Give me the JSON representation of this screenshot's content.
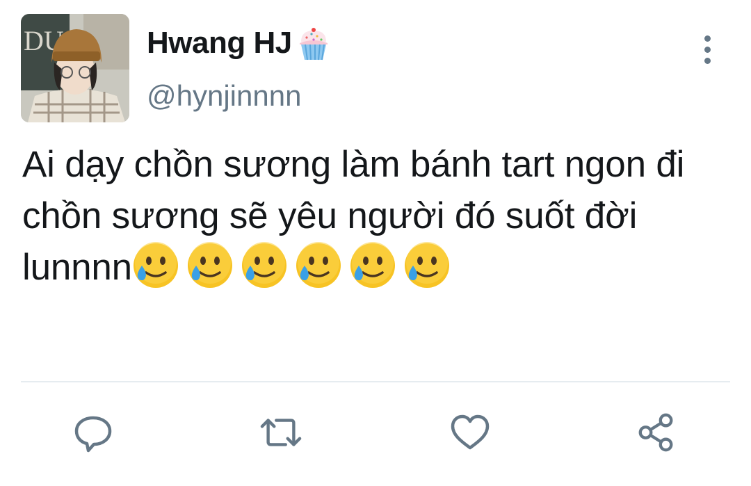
{
  "tweet": {
    "display_name": "Hwang HJ",
    "handle": "@hynjinnnn",
    "text": "Ai dạy chồn sương làm bánh tart ngon đi chồn sương sẽ yêu người đó suốt đời lunnnn",
    "emojis": [
      "smiling-face-with-tear",
      "smiling-face-with-tear",
      "smiling-face-with-tear",
      "smiling-face-with-tear",
      "smiling-face-with-tear",
      "smiling-face-with-tear"
    ],
    "name_badge_icon": "cupcake-icon"
  },
  "actions": [
    {
      "name": "reply",
      "icon": "comment-icon"
    },
    {
      "name": "retweet",
      "icon": "retweet-icon"
    },
    {
      "name": "like",
      "icon": "heart-icon"
    },
    {
      "name": "share",
      "icon": "share-icon"
    }
  ],
  "colors": {
    "text": "#14171a",
    "secondary": "#657786",
    "divider": "#e6ecf0",
    "emoji_face": "#f7c324",
    "tear": "#3aa0e6"
  }
}
